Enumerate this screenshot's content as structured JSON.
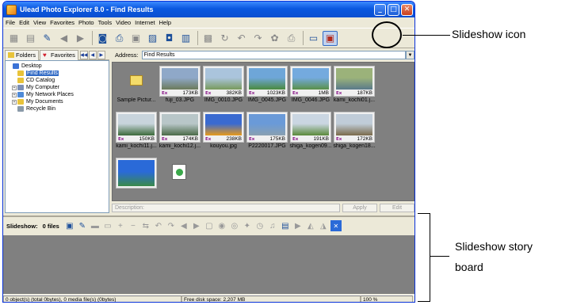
{
  "window": {
    "title": "Ulead Photo Explorer 8.0 - Find Results",
    "minimize": "_",
    "maximize": "□",
    "close": "✕"
  },
  "menu": [
    "File",
    "Edit",
    "View",
    "Favorites",
    "Photo",
    "Tools",
    "Video",
    "Internet",
    "Help"
  ],
  "toolbar": {
    "icons": [
      "thumbnail-view-icon",
      "browse-icon",
      "folder-up-icon",
      "back-icon",
      "forward-icon",
      "camera-icon",
      "scanner-icon",
      "acquire-icon",
      "edit-photo-icon",
      "convert-icon",
      "calendar-icon",
      "stitch-icon",
      "rotate-icon",
      "rotate-left-icon",
      "rotate-right-icon",
      "effects-icon",
      "print-icon",
      "monitor-icon",
      "slideshow-icon"
    ]
  },
  "tabs": {
    "folders": "Folders",
    "favorites": "Favorites"
  },
  "tree": [
    {
      "label": "Desktop",
      "expander": "",
      "icon": "#3a72d6",
      "indent": 0
    },
    {
      "label": "Find Results",
      "expander": "",
      "icon": "#e8c33a",
      "indent": 1,
      "selected": true
    },
    {
      "label": "CD Catalog",
      "expander": "",
      "icon": "#e8c33a",
      "indent": 1
    },
    {
      "label": "My Computer",
      "expander": "+",
      "icon": "#7c8fb5",
      "indent": 1
    },
    {
      "label": "My Network Places",
      "expander": "+",
      "icon": "#4e8ad8",
      "indent": 1
    },
    {
      "label": "My Documents",
      "expander": "+",
      "icon": "#e8c33a",
      "indent": 1
    },
    {
      "label": "Recycle Bin",
      "expander": "",
      "icon": "#8a9aa8",
      "indent": 1
    }
  ],
  "address": {
    "label": "Address:",
    "value": "Find Results"
  },
  "thumbnails": [
    {
      "name": "Sample Pictur...",
      "size": "",
      "kind": "folder"
    },
    {
      "name": "fuji_03.JPG",
      "size": "173KB",
      "kind": "photo",
      "sky": "#8fa8c8",
      "ground": "#6b7a5a"
    },
    {
      "name": "IMG_0010.JPG",
      "size": "382KB",
      "kind": "photo",
      "sky": "#aac4dc",
      "ground": "#789a5c"
    },
    {
      "name": "IMG_0045.JPG",
      "size": "1023KB",
      "kind": "photo",
      "sky": "#6ea6d8",
      "ground": "#4a8a3e"
    },
    {
      "name": "IMG_0046.JPG",
      "size": "1MB",
      "kind": "photo",
      "sky": "#74aade",
      "ground": "#5a9048"
    },
    {
      "name": "kami_kochi01.j...",
      "size": "187KB",
      "kind": "photo",
      "sky": "#9bb27a",
      "ground": "#5a7a8a"
    },
    {
      "name": "kami_kochi11.j...",
      "size": "150KB",
      "kind": "photo",
      "sky": "#c8d4dc",
      "ground": "#3c6a3a"
    },
    {
      "name": "kami_kochi12.j...",
      "size": "174KB",
      "kind": "photo",
      "sky": "#b8c6c8",
      "ground": "#4a6a48"
    },
    {
      "name": "kouyou.jpg",
      "size": "238KB",
      "kind": "photo",
      "sky": "#3a6ad0",
      "ground": "#e89a1a"
    },
    {
      "name": "P2220017.JPG",
      "size": "175KB",
      "kind": "photo",
      "sky": "#6a9ad8",
      "ground": "#8aa0b0"
    },
    {
      "name": "shiga_kogen09...",
      "size": "191KB",
      "kind": "photo",
      "sky": "#cad6e2",
      "ground": "#5a8a3a"
    },
    {
      "name": "shiga_kogen18...",
      "size": "172KB",
      "kind": "photo",
      "sky": "#c0ccd8",
      "ground": "#7a6a4a"
    },
    {
      "name": "",
      "size": "",
      "kind": "photo",
      "sky": "#2a6ad8",
      "ground": "#3a8a4a"
    },
    {
      "name": "",
      "size": "",
      "kind": "file"
    }
  ],
  "ex_badge": "Ex",
  "description": {
    "placeholder": "Description:",
    "apply": "Apply",
    "edit": "Edit"
  },
  "slideshow": {
    "label": "Slideshow:",
    "count": "0 files",
    "icons": [
      "add-to-slideshow-icon",
      "open-project-icon",
      "save-project-icon",
      "save-as-icon",
      "add-icon",
      "remove-icon",
      "swap-icon",
      "rotate-left-icon",
      "rotate-right-icon",
      "move-left-icon",
      "move-right-icon",
      "text-icon",
      "audio-icon",
      "transition-icon",
      "effect-icon",
      "timing-icon",
      "music-icon",
      "preview-icon",
      "play-icon",
      "export-icon",
      "upload-icon",
      "close-icon"
    ]
  },
  "status": {
    "objects": "0 object(s) (total 0bytes), 0 media file(s) (0bytes)",
    "disk": "Free disk space: 2,207 MB",
    "zoom": "100 %"
  },
  "annotations": {
    "slideshow_icon": "Slideshow icon",
    "storyboard_line1": "Slideshow story",
    "storyboard_line2": "board"
  },
  "colors": {
    "titlebar": "#0a58e0",
    "selection": "#316ac5",
    "workspace": "#808080"
  }
}
